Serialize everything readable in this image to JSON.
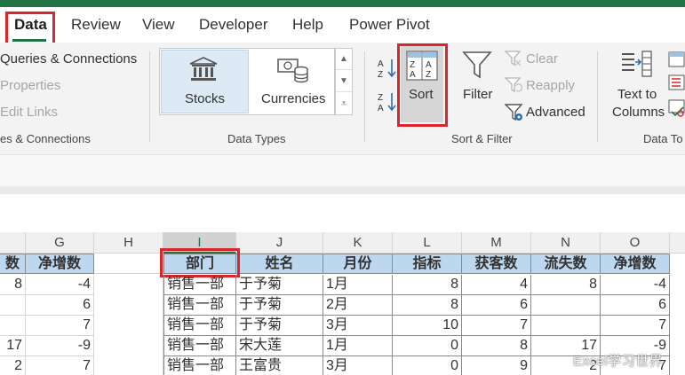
{
  "tabs": [
    {
      "label": "Data",
      "active": true
    },
    {
      "label": "Review"
    },
    {
      "label": "View"
    },
    {
      "label": "Developer"
    },
    {
      "label": "Help"
    },
    {
      "label": "Power Pivot"
    }
  ],
  "queries": {
    "queries_connections": "Queries & Connections",
    "properties": "Properties",
    "edit_links": "Edit Links",
    "group_label": "es & Connections"
  },
  "data_types": {
    "stocks": "Stocks",
    "currencies": "Currencies",
    "group_label": "Data Types"
  },
  "sort_filter": {
    "sort": "Sort",
    "filter": "Filter",
    "clear": "Clear",
    "reapply": "Reapply",
    "advanced": "Advanced",
    "group_label": "Sort & Filter"
  },
  "data_tools": {
    "text_to_columns_1": "Text to",
    "text_to_columns_2": "Columns",
    "group_label": "Data To"
  },
  "columns": [
    "G",
    "H",
    "I",
    "J",
    "K",
    "L",
    "M",
    "N",
    "O"
  ],
  "left": {
    "header": [
      "数",
      "净增数"
    ],
    "rows": [
      [
        "8",
        "-4"
      ],
      [
        "",
        "6"
      ],
      [
        "",
        "7"
      ],
      [
        "17",
        "-9"
      ],
      [
        "2",
        "7"
      ]
    ]
  },
  "table": {
    "headers": [
      "部门",
      "姓名",
      "月份",
      "指标",
      "获客数",
      "流失数",
      "净增数"
    ],
    "rows": [
      [
        "销售一部",
        "于予菊",
        "1月",
        "8",
        "4",
        "8",
        "-4"
      ],
      [
        "销售一部",
        "于予菊",
        "2月",
        "8",
        "6",
        "",
        "6"
      ],
      [
        "销售一部",
        "于予菊",
        "3月",
        "10",
        "7",
        "",
        "7"
      ],
      [
        "销售一部",
        "宋大莲",
        "1月",
        "0",
        "8",
        "17",
        "-9"
      ],
      [
        "销售一部",
        "王富贵",
        "3月",
        "0",
        "9",
        "2",
        "7"
      ]
    ]
  },
  "watermark": "Excel学习世界",
  "colors": {
    "accent": "#217346",
    "highlight": "#d9262d",
    "header_fill": "#bdd7ee"
  }
}
